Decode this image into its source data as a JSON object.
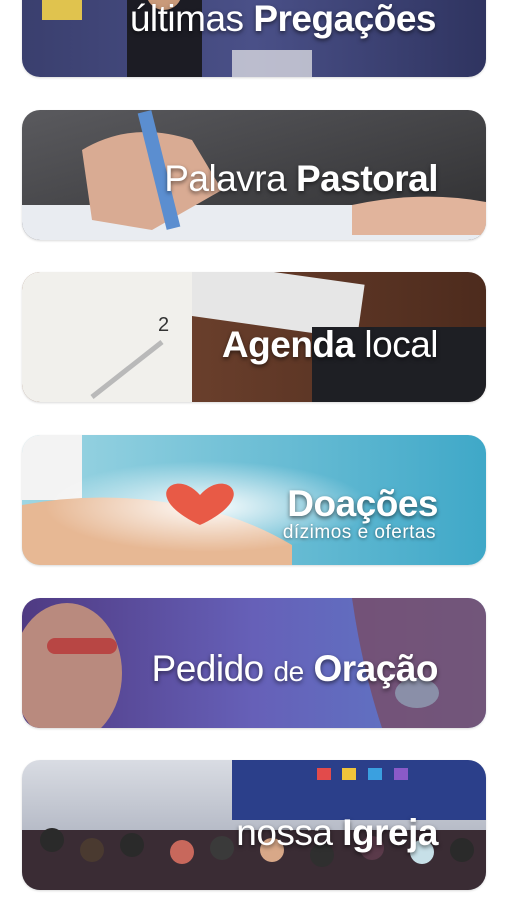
{
  "menu": {
    "preg": {
      "light": "últimas",
      "bold": "Pregações"
    },
    "pastoral": {
      "light": "Palavra",
      "bold": "Pastoral"
    },
    "agenda": {
      "bold": "Agenda",
      "light": "local"
    },
    "doacoes": {
      "bold": "Doações",
      "sub": "dízimos e ofertas"
    },
    "oracao": {
      "light1": "Pedido",
      "light2": "de",
      "bold": "Oração"
    },
    "igreja": {
      "light": "nossa",
      "bold": "Igreja"
    },
    "calendar_number": "2"
  }
}
